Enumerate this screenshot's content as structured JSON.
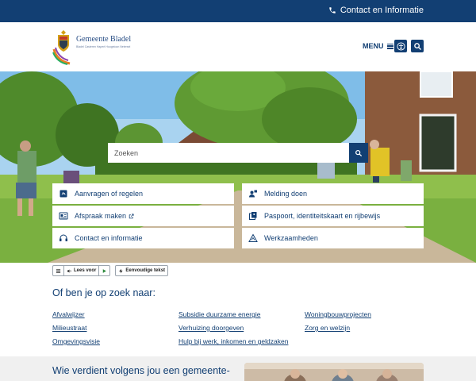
{
  "topbar": {
    "contact_label": "Contact en Informatie"
  },
  "header": {
    "logo_name": "Gemeente Bladel",
    "logo_villages": "Bladel  Casteren  Hapert  Hoogeloon  Netersel",
    "menu_label": "MENU"
  },
  "search": {
    "placeholder": "Zoeken"
  },
  "tiles": [
    {
      "label": "Aanvragen of regelen",
      "icon": "form-icon"
    },
    {
      "label": "Melding doen",
      "icon": "report-icon"
    },
    {
      "label": "Afspraak maken",
      "icon": "appointment-icon",
      "external": true
    },
    {
      "label": "Paspoort, identiteitskaart en rijbewijs",
      "icon": "passport-icon"
    },
    {
      "label": "Contact en informatie",
      "icon": "headset-icon"
    },
    {
      "label": "Werkzaamheden",
      "icon": "roadwork-icon"
    }
  ],
  "readspeaker": {
    "read_label": "Lees voor",
    "simple_label": "Eenvoudige tekst"
  },
  "looking_for": {
    "title": "Of ben je op zoek naar:",
    "links": [
      "Afvalwijzer",
      "Subsidie duurzame energie",
      "Woningbouwprojecten",
      "Milieustraat",
      "Verhuizing doorgeven",
      "Zorg en welzijn",
      "Omgevingsvisie",
      "Hulp bij werk, inkomen en geldzaken"
    ]
  },
  "bottom": {
    "question": "Wie verdient volgens jou een gemeente-"
  },
  "colors": {
    "primary": "#123f73",
    "link": "#123f73",
    "grass": "#5f9a33"
  }
}
